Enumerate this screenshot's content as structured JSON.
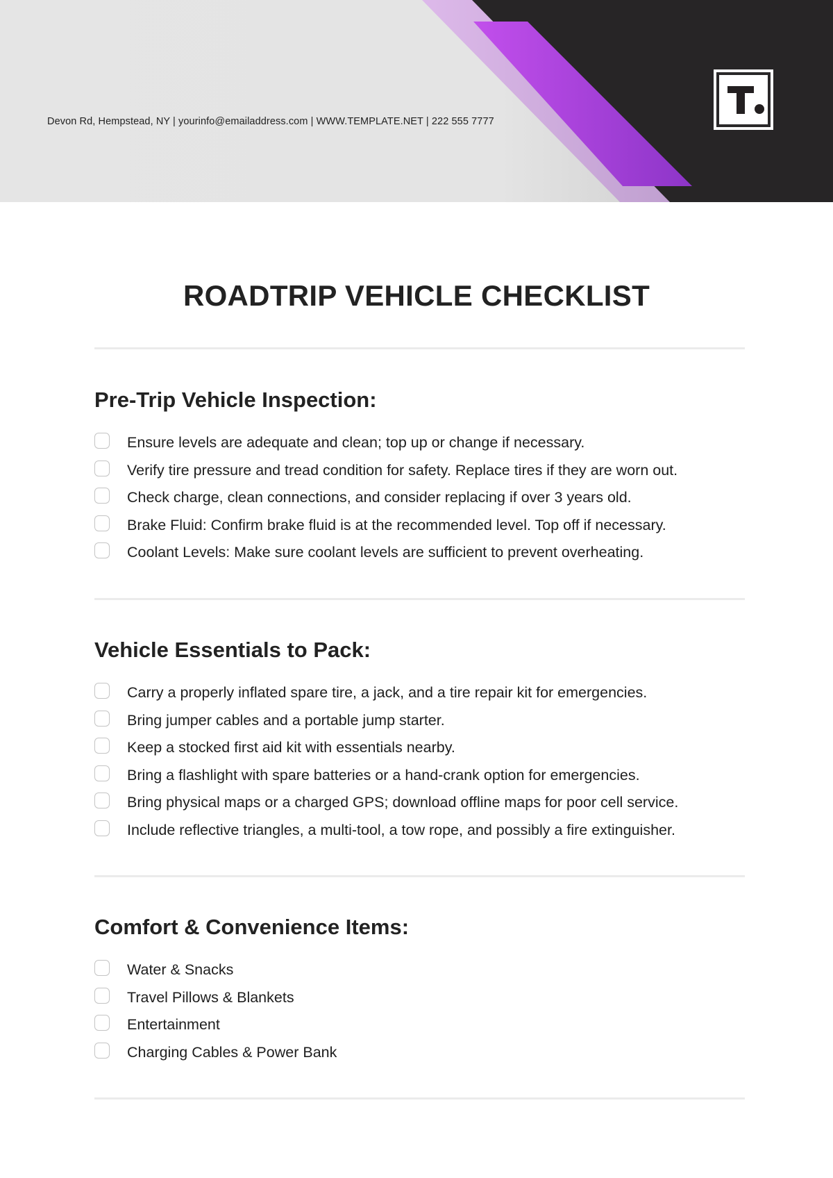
{
  "header": {
    "contact_line": "Devon Rd, Hempstead, NY | yourinfo@emailaddress.com | WWW.TEMPLATE.NET | 222 555 7777",
    "logo_letter": "T",
    "colors": {
      "header_bg": "#e4e4e4",
      "dark_panel": "#272526",
      "light_purple_band": "#d9b8e8",
      "purple_accent_start": "#c04fea",
      "purple_accent_end": "#8e36c9",
      "logo_bg": "#ffffff"
    }
  },
  "document": {
    "title": "ROADTRIP VEHICLE CHECKLIST",
    "sections": [
      {
        "heading": "Pre-Trip Vehicle Inspection:",
        "items": [
          {
            "text": "Ensure levels are adequate and clean; top up or change if necessary.",
            "checked": false
          },
          {
            "text": "Verify tire pressure and tread condition for safety. Replace tires if they are worn out.",
            "checked": false
          },
          {
            "text": "Check charge, clean connections, and consider replacing if over 3 years old.",
            "checked": false
          },
          {
            "text": "Brake Fluid: Confirm brake fluid is at the recommended level. Top off if necessary.",
            "checked": false
          },
          {
            "text": "Coolant Levels: Make sure coolant levels are sufficient to prevent overheating.",
            "checked": false
          }
        ]
      },
      {
        "heading": "Vehicle Essentials to Pack:",
        "items": [
          {
            "text": "Carry a properly inflated spare tire, a jack, and a tire repair kit for emergencies.",
            "checked": false
          },
          {
            "text": "Bring jumper cables and a portable jump starter.",
            "checked": false
          },
          {
            "text": "Keep a stocked first aid kit with essentials nearby.",
            "checked": false
          },
          {
            "text": "Bring a flashlight with spare batteries or a hand-crank option for emergencies.",
            "checked": false
          },
          {
            "text": "Bring physical maps or a charged GPS; download offline maps for poor cell service.",
            "checked": false
          },
          {
            "text": "Include reflective triangles, a multi-tool, a tow rope, and possibly a fire extinguisher.",
            "checked": false
          }
        ]
      },
      {
        "heading": "Comfort & Convenience Items:",
        "items": [
          {
            "text": "Water & Snacks",
            "checked": false
          },
          {
            "text": "Travel Pillows & Blankets",
            "checked": false
          },
          {
            "text": "Entertainment",
            "checked": false
          },
          {
            "text": "Charging Cables & Power Bank",
            "checked": false
          }
        ]
      }
    ]
  }
}
